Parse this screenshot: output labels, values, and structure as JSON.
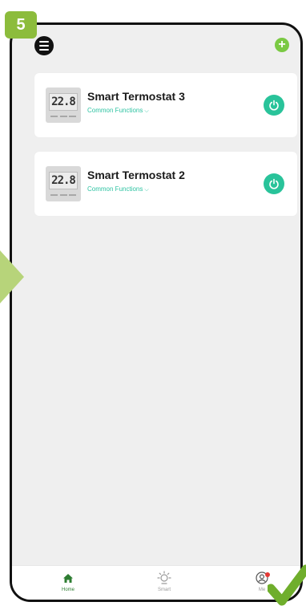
{
  "step": {
    "number": "5"
  },
  "topbar": {
    "menu_icon": "menu-icon",
    "add_icon": "add-icon"
  },
  "devices": [
    {
      "name": "Smart Termostat 3",
      "functions_label": "Common Functions",
      "display": "22.8"
    },
    {
      "name": "Smart Termostat 2",
      "functions_label": "Common Functions",
      "display": "22.8"
    }
  ],
  "tabbar": {
    "tabs": [
      {
        "label": "Home",
        "icon": "home-icon",
        "active": true
      },
      {
        "label": "Smart",
        "icon": "smart-icon",
        "active": false
      },
      {
        "label": "Me",
        "icon": "profile-icon",
        "active": false
      }
    ]
  },
  "colors": {
    "badge": "#8cbc3c",
    "accent_green": "#7ac943",
    "power": "#29c39a",
    "function_link": "#2ec3a2",
    "active_tab": "#2e7d32",
    "background": "#efefef"
  }
}
